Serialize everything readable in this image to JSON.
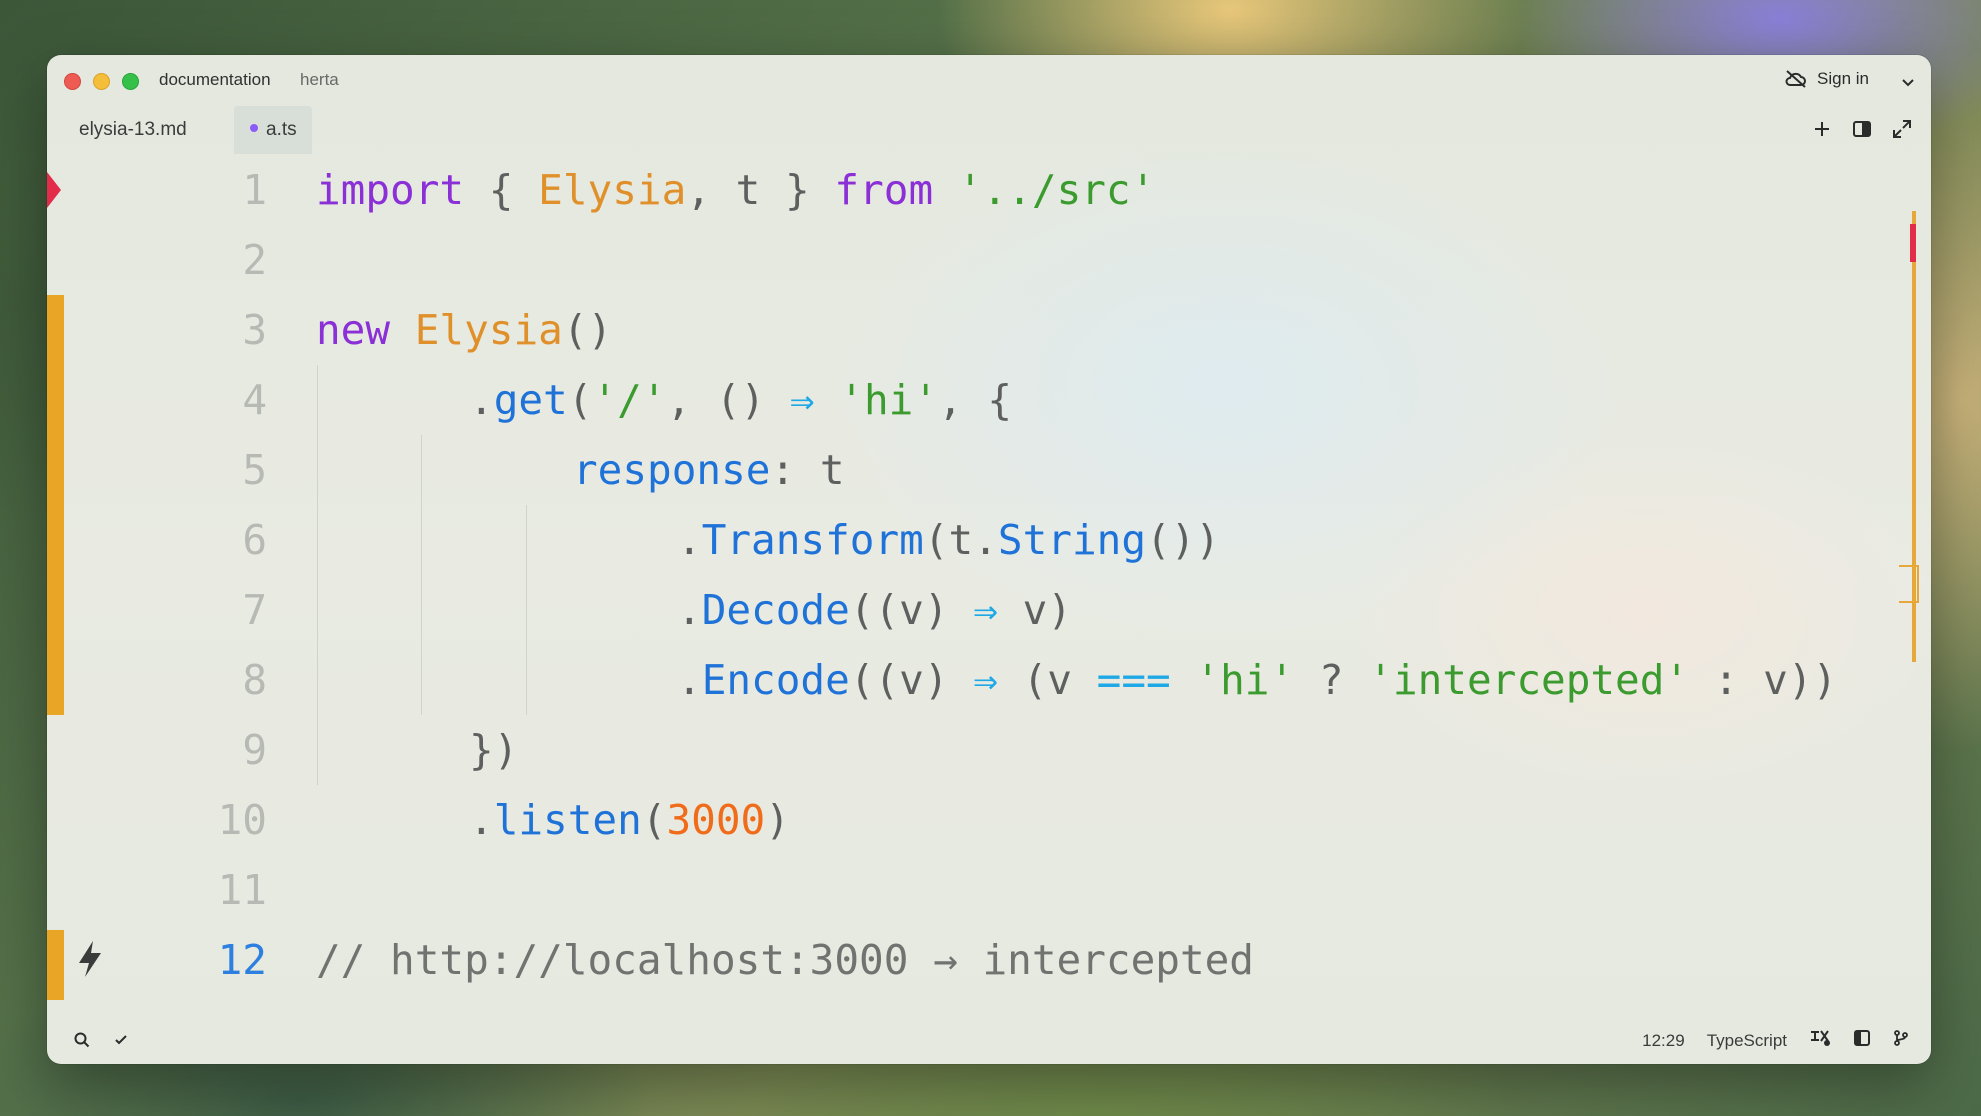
{
  "titlebar": {
    "project": "documentation",
    "branch": "herta",
    "sign_in": "Sign in"
  },
  "tabs": [
    {
      "label": "elysia-13.md",
      "active": false,
      "modified": false
    },
    {
      "label": "a.ts",
      "active": true,
      "modified": true
    }
  ],
  "editor": {
    "line_numbers": [
      "1",
      "2",
      "3",
      "4",
      "5",
      "6",
      "7",
      "8",
      "9",
      "10",
      "11",
      "12"
    ],
    "active_line": "12",
    "lines": {
      "l1": {
        "a": "import",
        "b": " { ",
        "c": "Elysia",
        "d": ", t } ",
        "e": "from",
        "f": " ",
        "g": "'../src'"
      },
      "l3": {
        "a": "new",
        "b": " ",
        "c": "Elysia",
        "d": "()"
      },
      "l4": {
        "a": ".",
        "b": "get",
        "c": "(",
        "d": "'/'",
        "e": ", () ",
        "f": "⇒",
        "g": " ",
        "h": "'hi'",
        "i": ", {"
      },
      "l5": {
        "a": "response",
        "b": ": t"
      },
      "l6": {
        "a": ".",
        "b": "Transform",
        "c": "(t.",
        "d": "String",
        "e": "())"
      },
      "l7": {
        "a": ".",
        "b": "Decode",
        "c": "((v) ",
        "d": "⇒",
        "e": " v)"
      },
      "l8": {
        "a": ".",
        "b": "Encode",
        "c": "((v) ",
        "d": "⇒",
        "e": " (v ",
        "f": "===",
        "g": " ",
        "h": "'hi'",
        "i": " ? ",
        "j": "'intercepted'",
        "k": " : v))"
      },
      "l9": {
        "a": "})"
      },
      "l10": {
        "a": ".",
        "b": "listen",
        "c": "(",
        "d": "3000",
        "e": ")"
      },
      "l12": {
        "a": "// http://localhost:3000 → intercepted"
      }
    }
  },
  "status": {
    "cursor": "12:29",
    "language": "TypeScript"
  },
  "colors": {
    "keyword": "#8b2fd6",
    "class": "#e0902a",
    "string": "#3b9b2f",
    "function": "#1f73d8",
    "operator": "#1fa8e6",
    "number": "#f06c1a",
    "git_modified": "#e8a526",
    "breakpoint": "#e12d4a"
  },
  "icons": [
    "cloud-off-icon",
    "chevron-down-icon",
    "plus-icon",
    "split-pane-icon",
    "expand-icon",
    "bolt-icon",
    "search-icon",
    "check-icon",
    "ai-icon",
    "panel-icon",
    "git-branch-icon"
  ]
}
